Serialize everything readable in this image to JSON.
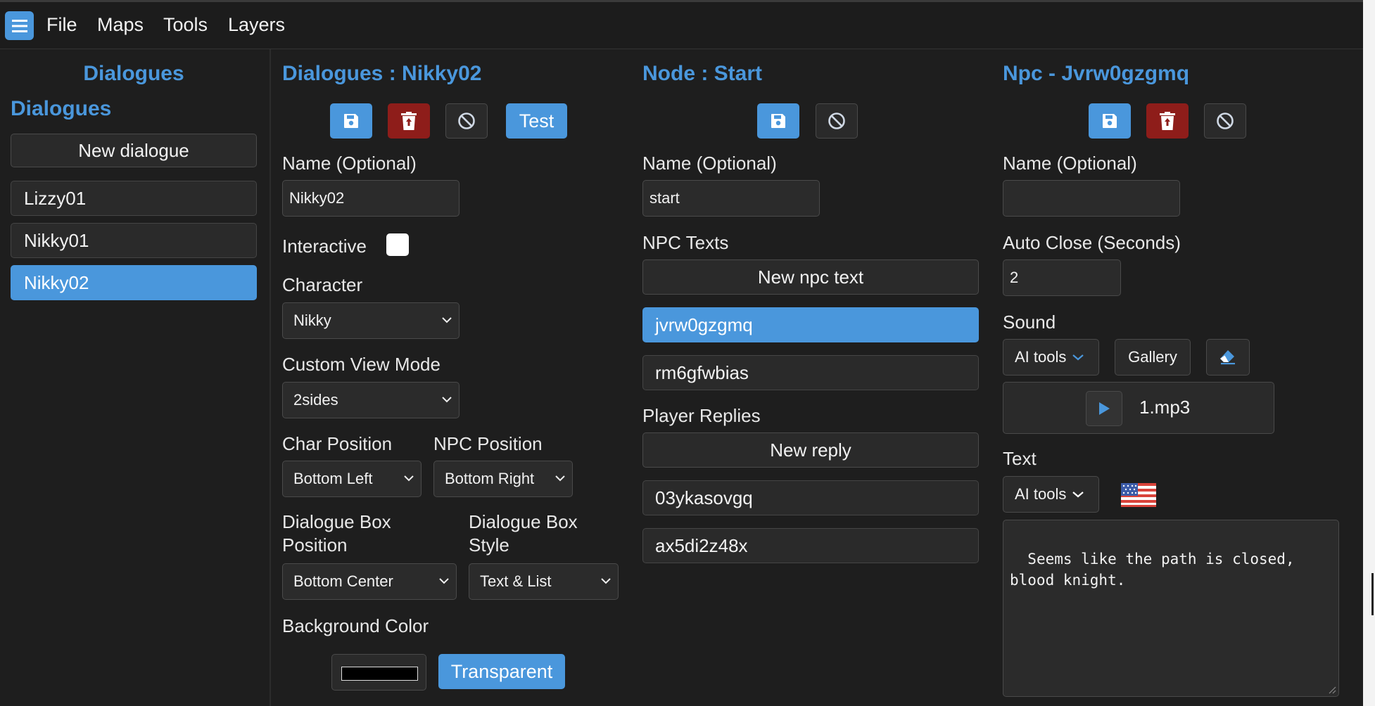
{
  "menu": {
    "items": [
      {
        "label": "File"
      },
      {
        "label": "Maps"
      },
      {
        "label": "Tools"
      },
      {
        "label": "Layers"
      }
    ]
  },
  "sidebar": {
    "title": "Dialogues",
    "subtitle": "Dialogues",
    "new_button": "New dialogue",
    "items": [
      {
        "label": "Lizzy01",
        "selected": false
      },
      {
        "label": "Nikky01",
        "selected": false
      },
      {
        "label": "Nikky02",
        "selected": true
      }
    ]
  },
  "dialogue_panel": {
    "title": "Dialogues : Nikky02",
    "test_label": "Test",
    "name_label": "Name (Optional)",
    "name_value": "Nikky02",
    "interactive_label": "Interactive",
    "interactive_checked": false,
    "character_label": "Character",
    "character_value": "Nikky",
    "view_mode_label": "Custom View Mode",
    "view_mode_value": "2sides",
    "char_position_label": "Char Position",
    "char_position_value": "Bottom Left",
    "npc_position_label": "NPC Position",
    "npc_position_value": "Bottom Right",
    "box_position_label": "Dialogue Box Position",
    "box_position_value": "Bottom Center",
    "box_style_label": "Dialogue Box Style",
    "box_style_value": "Text & List",
    "bg_color_label": "Background Color",
    "bg_color_value": "#000000",
    "transparent_label": "Transparent"
  },
  "node_panel": {
    "title": "Node : Start",
    "name_label": "Name (Optional)",
    "name_value": "start",
    "npc_texts_label": "NPC Texts",
    "new_npc_text": "New npc text",
    "npc_texts": [
      {
        "label": "jvrw0gzgmq",
        "selected": true
      },
      {
        "label": "rm6gfwbias",
        "selected": false
      }
    ],
    "replies_label": "Player Replies",
    "new_reply": "New reply",
    "replies": [
      {
        "label": "03ykasovgq"
      },
      {
        "label": "ax5di2z48x"
      }
    ]
  },
  "npc_panel": {
    "title": "Npc - Jvrw0gzgmq",
    "name_label": "Name (Optional)",
    "name_value": "",
    "auto_close_label": "Auto Close (Seconds)",
    "auto_close_value": "2",
    "sound_label": "Sound",
    "ai_tools_label": "AI tools",
    "gallery_label": "Gallery",
    "sound_file": "1.mp3",
    "text_label": "Text",
    "text_ai_tools_label": "AI tools",
    "text_value": "Seems like the path is closed,\nblood knight."
  },
  "colors": {
    "accent": "#4a97dc",
    "danger": "#8e1d1a",
    "background": "#1e1e1e"
  }
}
